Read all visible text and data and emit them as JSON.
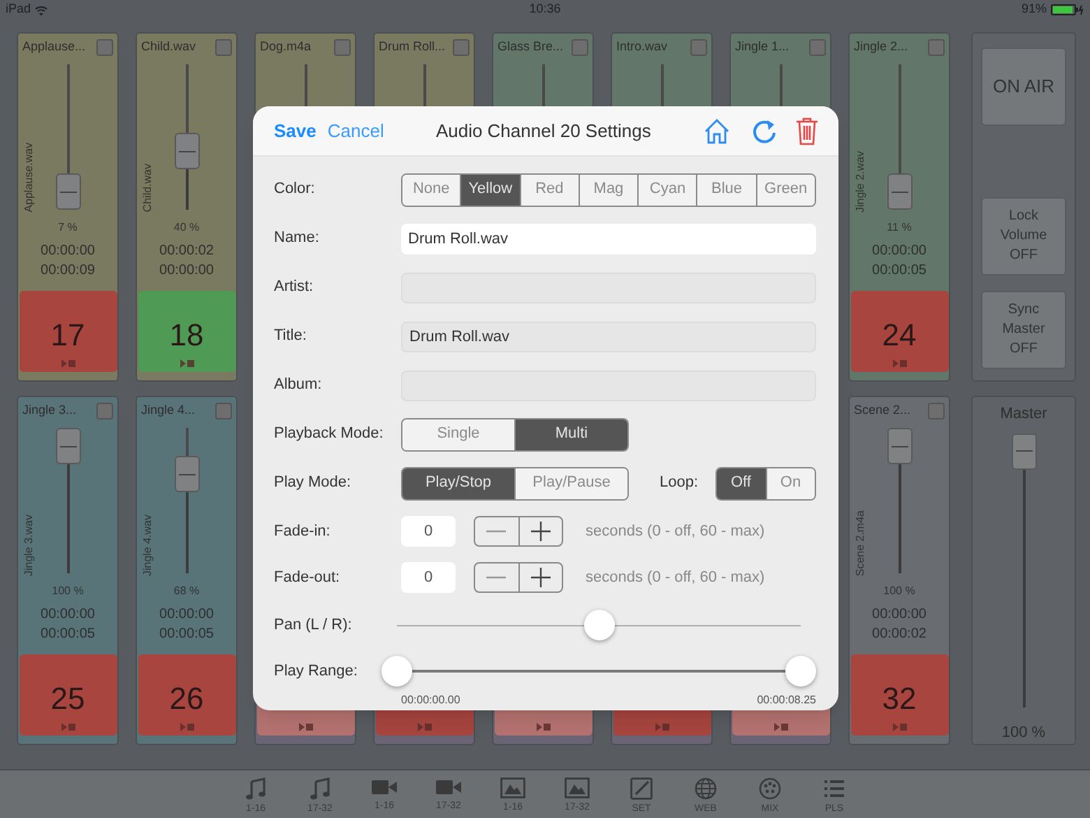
{
  "status_bar": {
    "device": "iPad",
    "time": "10:36",
    "battery": "91%"
  },
  "channels": [
    {
      "name": "Applause...",
      "color": "#7a7a61",
      "checked": false,
      "file": "Applause.wav",
      "level": 0.07,
      "percent": "7 %",
      "elapsed": "00:00:00",
      "remaining": "00:00:09",
      "pad": {
        "number": "17",
        "color": "#a8453f"
      }
    },
    {
      "name": "Child.wav",
      "color": "#7a7a61",
      "checked": false,
      "file": "Child.wav",
      "level": 0.4,
      "percent": "40 %",
      "elapsed": "00:00:02",
      "remaining": "00:00:00",
      "pad": {
        "number": "18",
        "color": "#4f9a55"
      }
    },
    {
      "name": "Dog.m4a",
      "color": "#7a7a61",
      "checked": false
    },
    {
      "name": "Drum Roll...",
      "color": "#7a7a61",
      "checked": false
    },
    {
      "name": "Glass Bre...",
      "color": "#62776a",
      "checked": false
    },
    {
      "name": "Intro.wav",
      "color": "#62776a",
      "checked": false
    },
    {
      "name": "Jingle 1...",
      "color": "#62776a",
      "checked": false
    },
    {
      "name": "Jingle 2...",
      "color": "#62776a",
      "checked": false,
      "file": "Jingle 2.wav",
      "level": 0.11,
      "percent": "11 %",
      "elapsed": "00:00:00",
      "remaining": "00:00:05",
      "pad": {
        "number": "24",
        "color": "#a8453f"
      }
    },
    {
      "name": "Jingle 3...",
      "color": "#587478",
      "checked": false,
      "file": "Jingle 3.wav",
      "level": 1,
      "percent": "100 %",
      "elapsed": "00:00:00",
      "remaining": "00:00:05",
      "pad": {
        "number": "25",
        "color": "#a8453f"
      }
    },
    {
      "name": "Jingle 4...",
      "color": "#587478",
      "checked": false,
      "file": "Jingle 4.wav",
      "level": 0.68,
      "percent": "68 %",
      "elapsed": "00:00:00",
      "remaining": "00:00:05",
      "pad": {
        "number": "26",
        "color": "#a8453f"
      }
    },
    {
      "color": "#6a6474",
      "pad": {
        "color": "#b57370"
      }
    },
    {
      "color": "#6a6474",
      "pad": {
        "color": "#a8453f"
      }
    },
    {
      "color": "#6a6474",
      "pad": {
        "color": "#b57370"
      }
    },
    {
      "color": "#6a6474",
      "pad": {
        "color": "#a8453f"
      }
    },
    {
      "color": "#6a6474",
      "pad": {
        "color": "#b57370"
      }
    },
    {
      "name": "Scene 2...",
      "color": "#696c70",
      "checked": false,
      "file": "Scene 2.m4a",
      "level": 1,
      "percent": "100 %",
      "elapsed": "00:00:00",
      "remaining": "00:00:02",
      "pad": {
        "number": "32",
        "color": "#a8453f"
      }
    }
  ],
  "controls": [
    {
      "label": "ON AIR"
    },
    {
      "label": "Lock Volume OFF"
    },
    {
      "label": "Sync Master OFF"
    }
  ],
  "master": {
    "title": "Master",
    "level": 1,
    "percent": "100 %"
  },
  "toolbar": [
    {
      "kind": "music",
      "label": "1-16"
    },
    {
      "kind": "music",
      "label": "17-32"
    },
    {
      "kind": "video",
      "label": "1-16"
    },
    {
      "kind": "video",
      "label": "17-32"
    },
    {
      "kind": "image",
      "label": "1-16"
    },
    {
      "kind": "image",
      "label": "17-32"
    },
    {
      "kind": "edit",
      "label": "SET"
    },
    {
      "kind": "globe",
      "label": "WEB"
    },
    {
      "kind": "mixer",
      "label": "MIX"
    },
    {
      "kind": "list",
      "label": "PLS"
    }
  ],
  "dialog": {
    "save": "Save",
    "cancel": "Cancel",
    "title": "Audio Channel 20 Settings",
    "color": {
      "label": "Color:",
      "options": [
        {
          "label": "None",
          "selected": false
        },
        {
          "label": "Yellow",
          "selected": true
        },
        {
          "label": "Red",
          "selected": false
        },
        {
          "label": "Mag",
          "selected": false
        },
        {
          "label": "Cyan",
          "selected": false
        },
        {
          "label": "Blue",
          "selected": false
        },
        {
          "label": "Green",
          "selected": false
        }
      ]
    },
    "text_fields": [
      {
        "label": "Name:",
        "value": "Drum Roll.wav",
        "focused": true
      },
      {
        "label": "Artist:",
        "focused": false
      },
      {
        "label": "Title:",
        "value": "Drum Roll.wav",
        "focused": false
      },
      {
        "label": "Album:",
        "focused": false
      }
    ],
    "playback_mode": {
      "label": "Playback Mode:",
      "options": [
        {
          "label": "Single",
          "selected": false
        },
        {
          "label": "Multi",
          "selected": true
        }
      ]
    },
    "play_mode": {
      "label": "Play Mode:",
      "options": [
        {
          "label": "Play/Stop",
          "selected": true
        },
        {
          "label": "Play/Pause",
          "selected": false
        }
      ]
    },
    "loop": {
      "label": "Loop:",
      "options": [
        {
          "label": "Off",
          "selected": true
        },
        {
          "label": "On",
          "selected": false
        }
      ]
    },
    "fades": [
      {
        "label": "Fade-in:",
        "value": "0",
        "hint": "seconds (0 - off, 60 - max)"
      },
      {
        "label": "Fade-out:",
        "value": "0",
        "hint": "seconds (0 - off, 60 - max)"
      }
    ],
    "pan": {
      "label": "Pan (L / R):",
      "level": 0.5
    },
    "play_range": {
      "label": "Play Range:",
      "handles": [
        {
          "level": 0,
          "time": "00:00:00.00"
        },
        {
          "level": 1,
          "time": "00:00:08.25"
        }
      ]
    }
  }
}
